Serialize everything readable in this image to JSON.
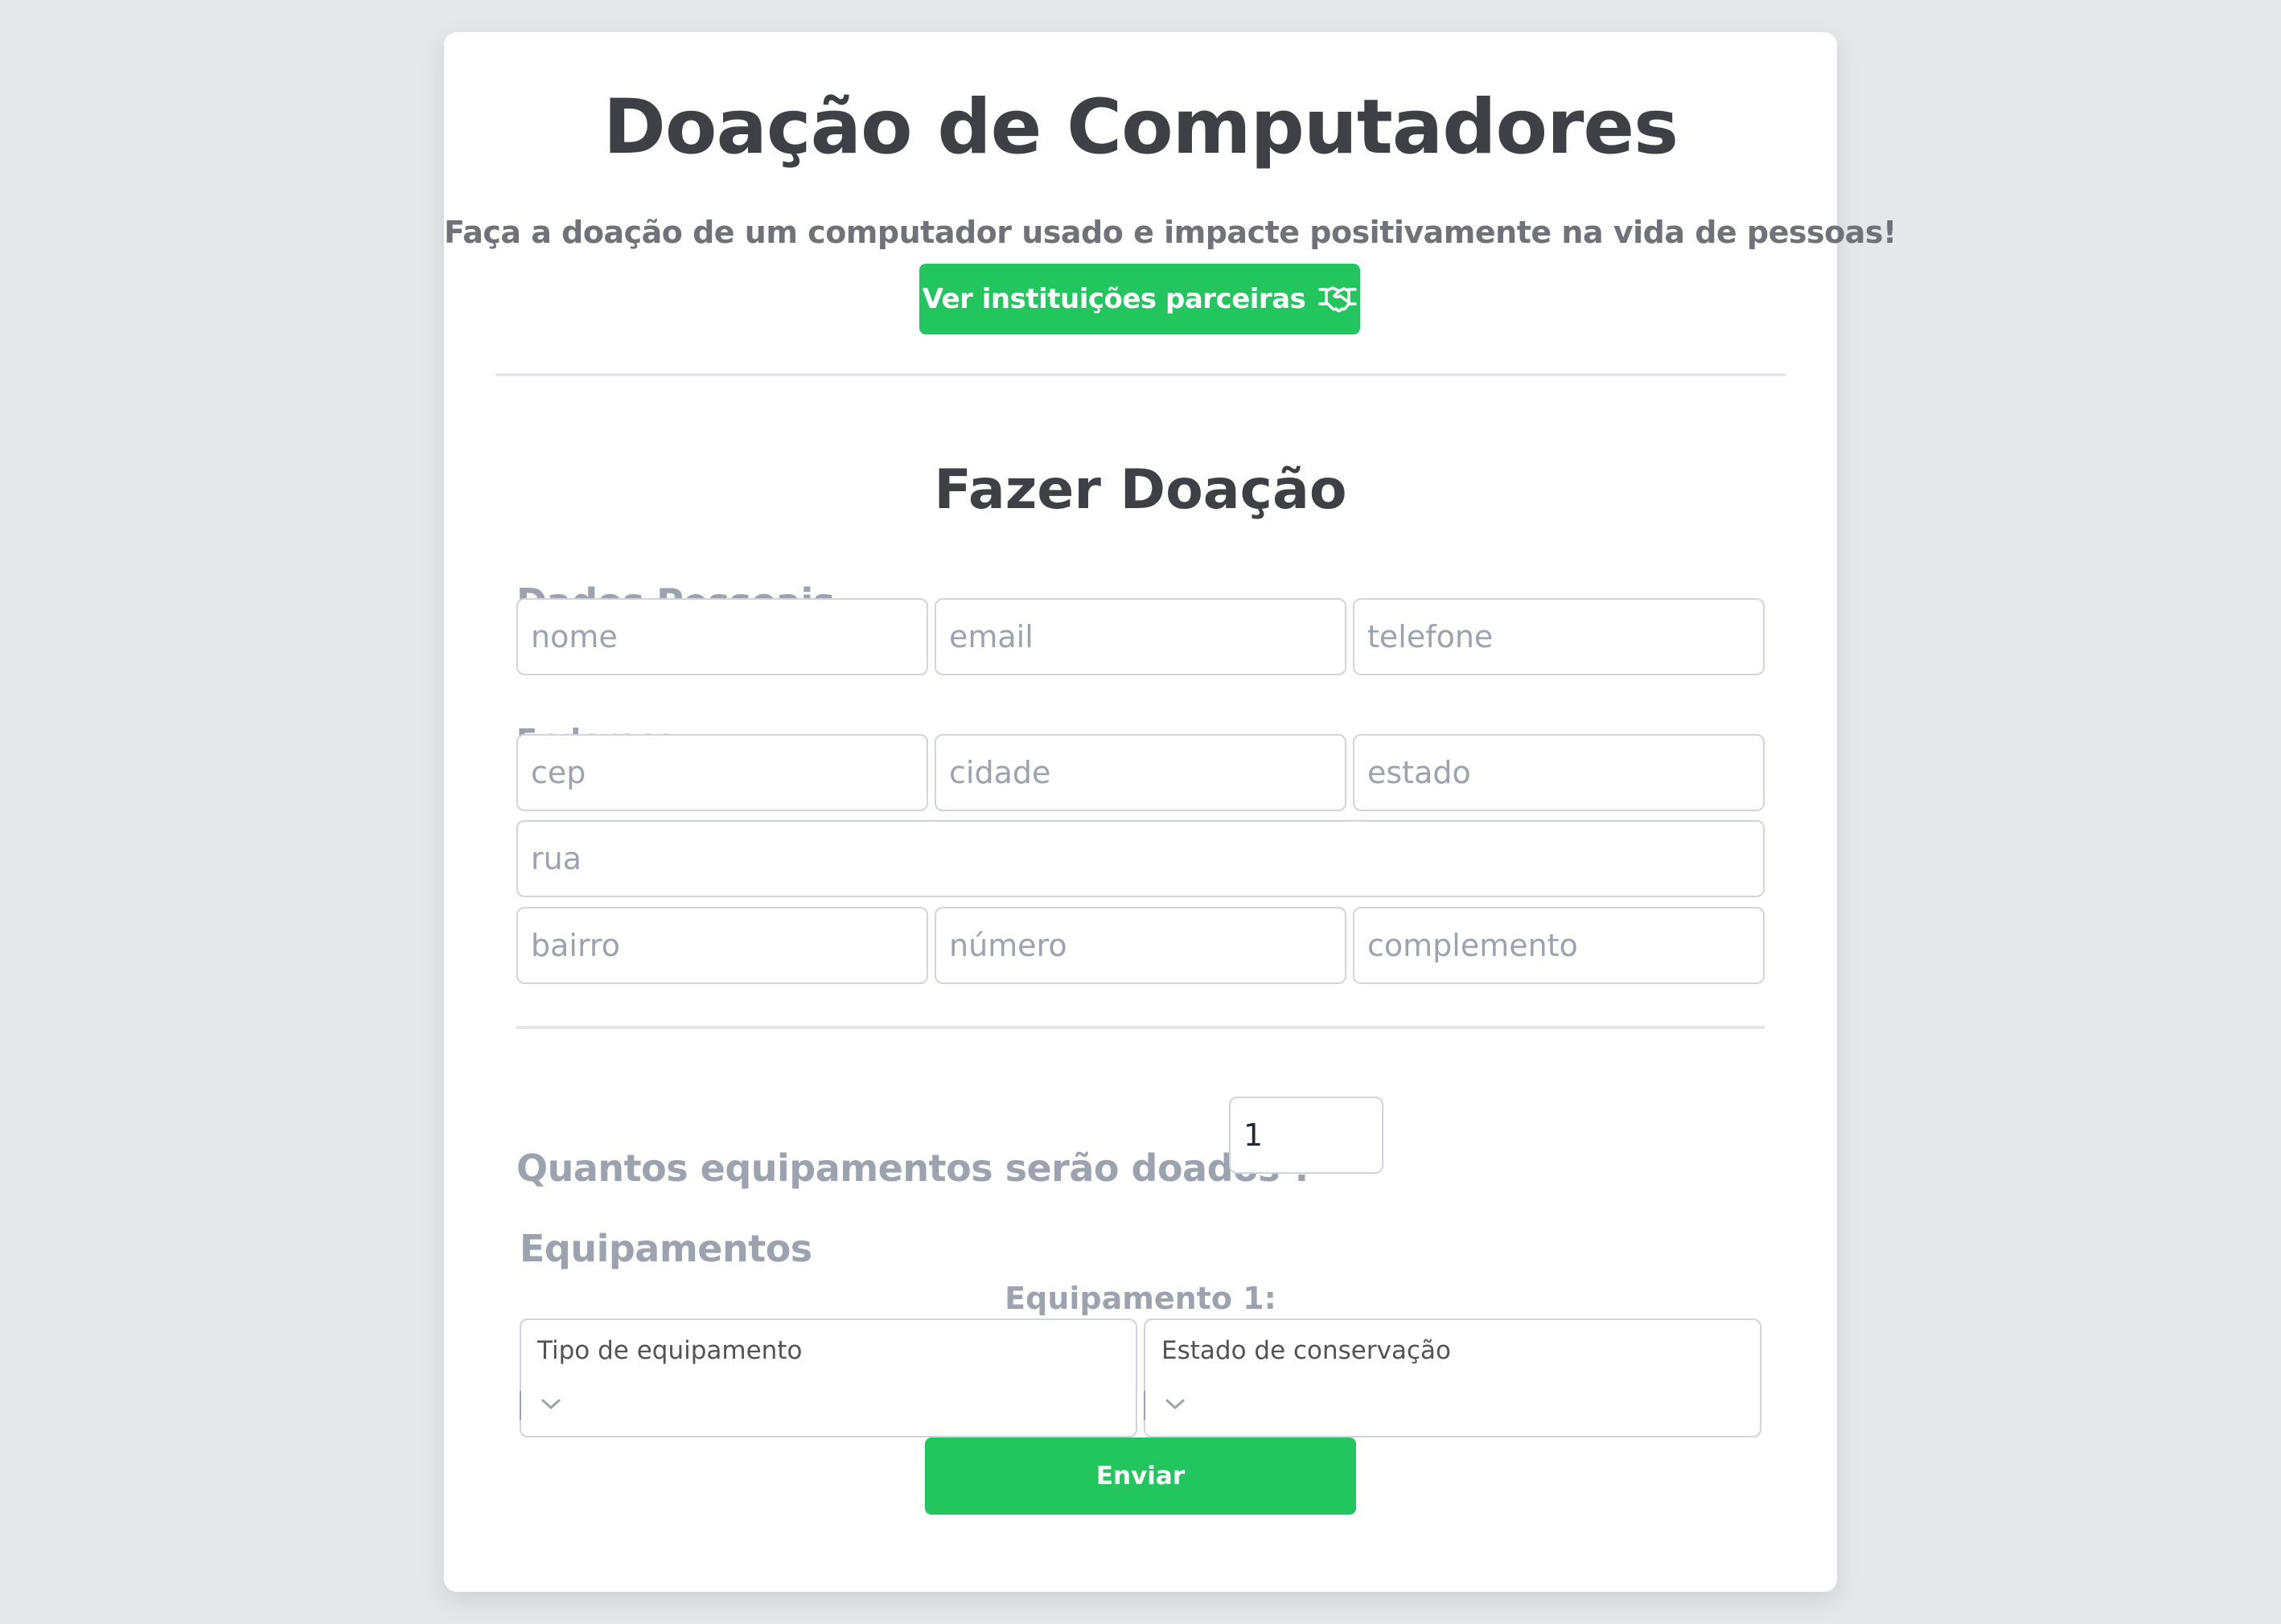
{
  "header": {
    "title": "Doação de Computadores",
    "subtitle": "Faça a doação de um computador usado e impacte positivamente na vida de pessoas!",
    "partners_button_label": "Ver instituições parceiras",
    "partners_button_icon": "handshake-icon"
  },
  "form": {
    "title": "Fazer Doação",
    "personal_section_label": "Dados Pessoais",
    "personal_fields": {
      "name_placeholder": "nome",
      "email_placeholder": "email",
      "phone_placeholder": "telefone"
    },
    "address_section_label": "Endereço",
    "address_fields": {
      "cep_placeholder": "cep",
      "city_placeholder": "cidade",
      "state_placeholder": "estado",
      "street_placeholder": "rua",
      "neighborhood_placeholder": "bairro",
      "number_placeholder": "número",
      "complement_placeholder": "complemento"
    },
    "quantity_label": "Quantos equipamentos serão doados ?",
    "quantity_value": "1",
    "equipment_section_label": "Equipamentos",
    "equipment_items": [
      {
        "heading": "Equipamento 1:",
        "type_label": "Tipo de equipamento",
        "condition_label": "Estado de conservação"
      }
    ],
    "submit_label": "Enviar"
  },
  "colors": {
    "accent": "#22c55e",
    "background": "#e5e7eb",
    "card": "#ffffff",
    "heading": "#3f3f46",
    "muted": "#9ca3af"
  }
}
